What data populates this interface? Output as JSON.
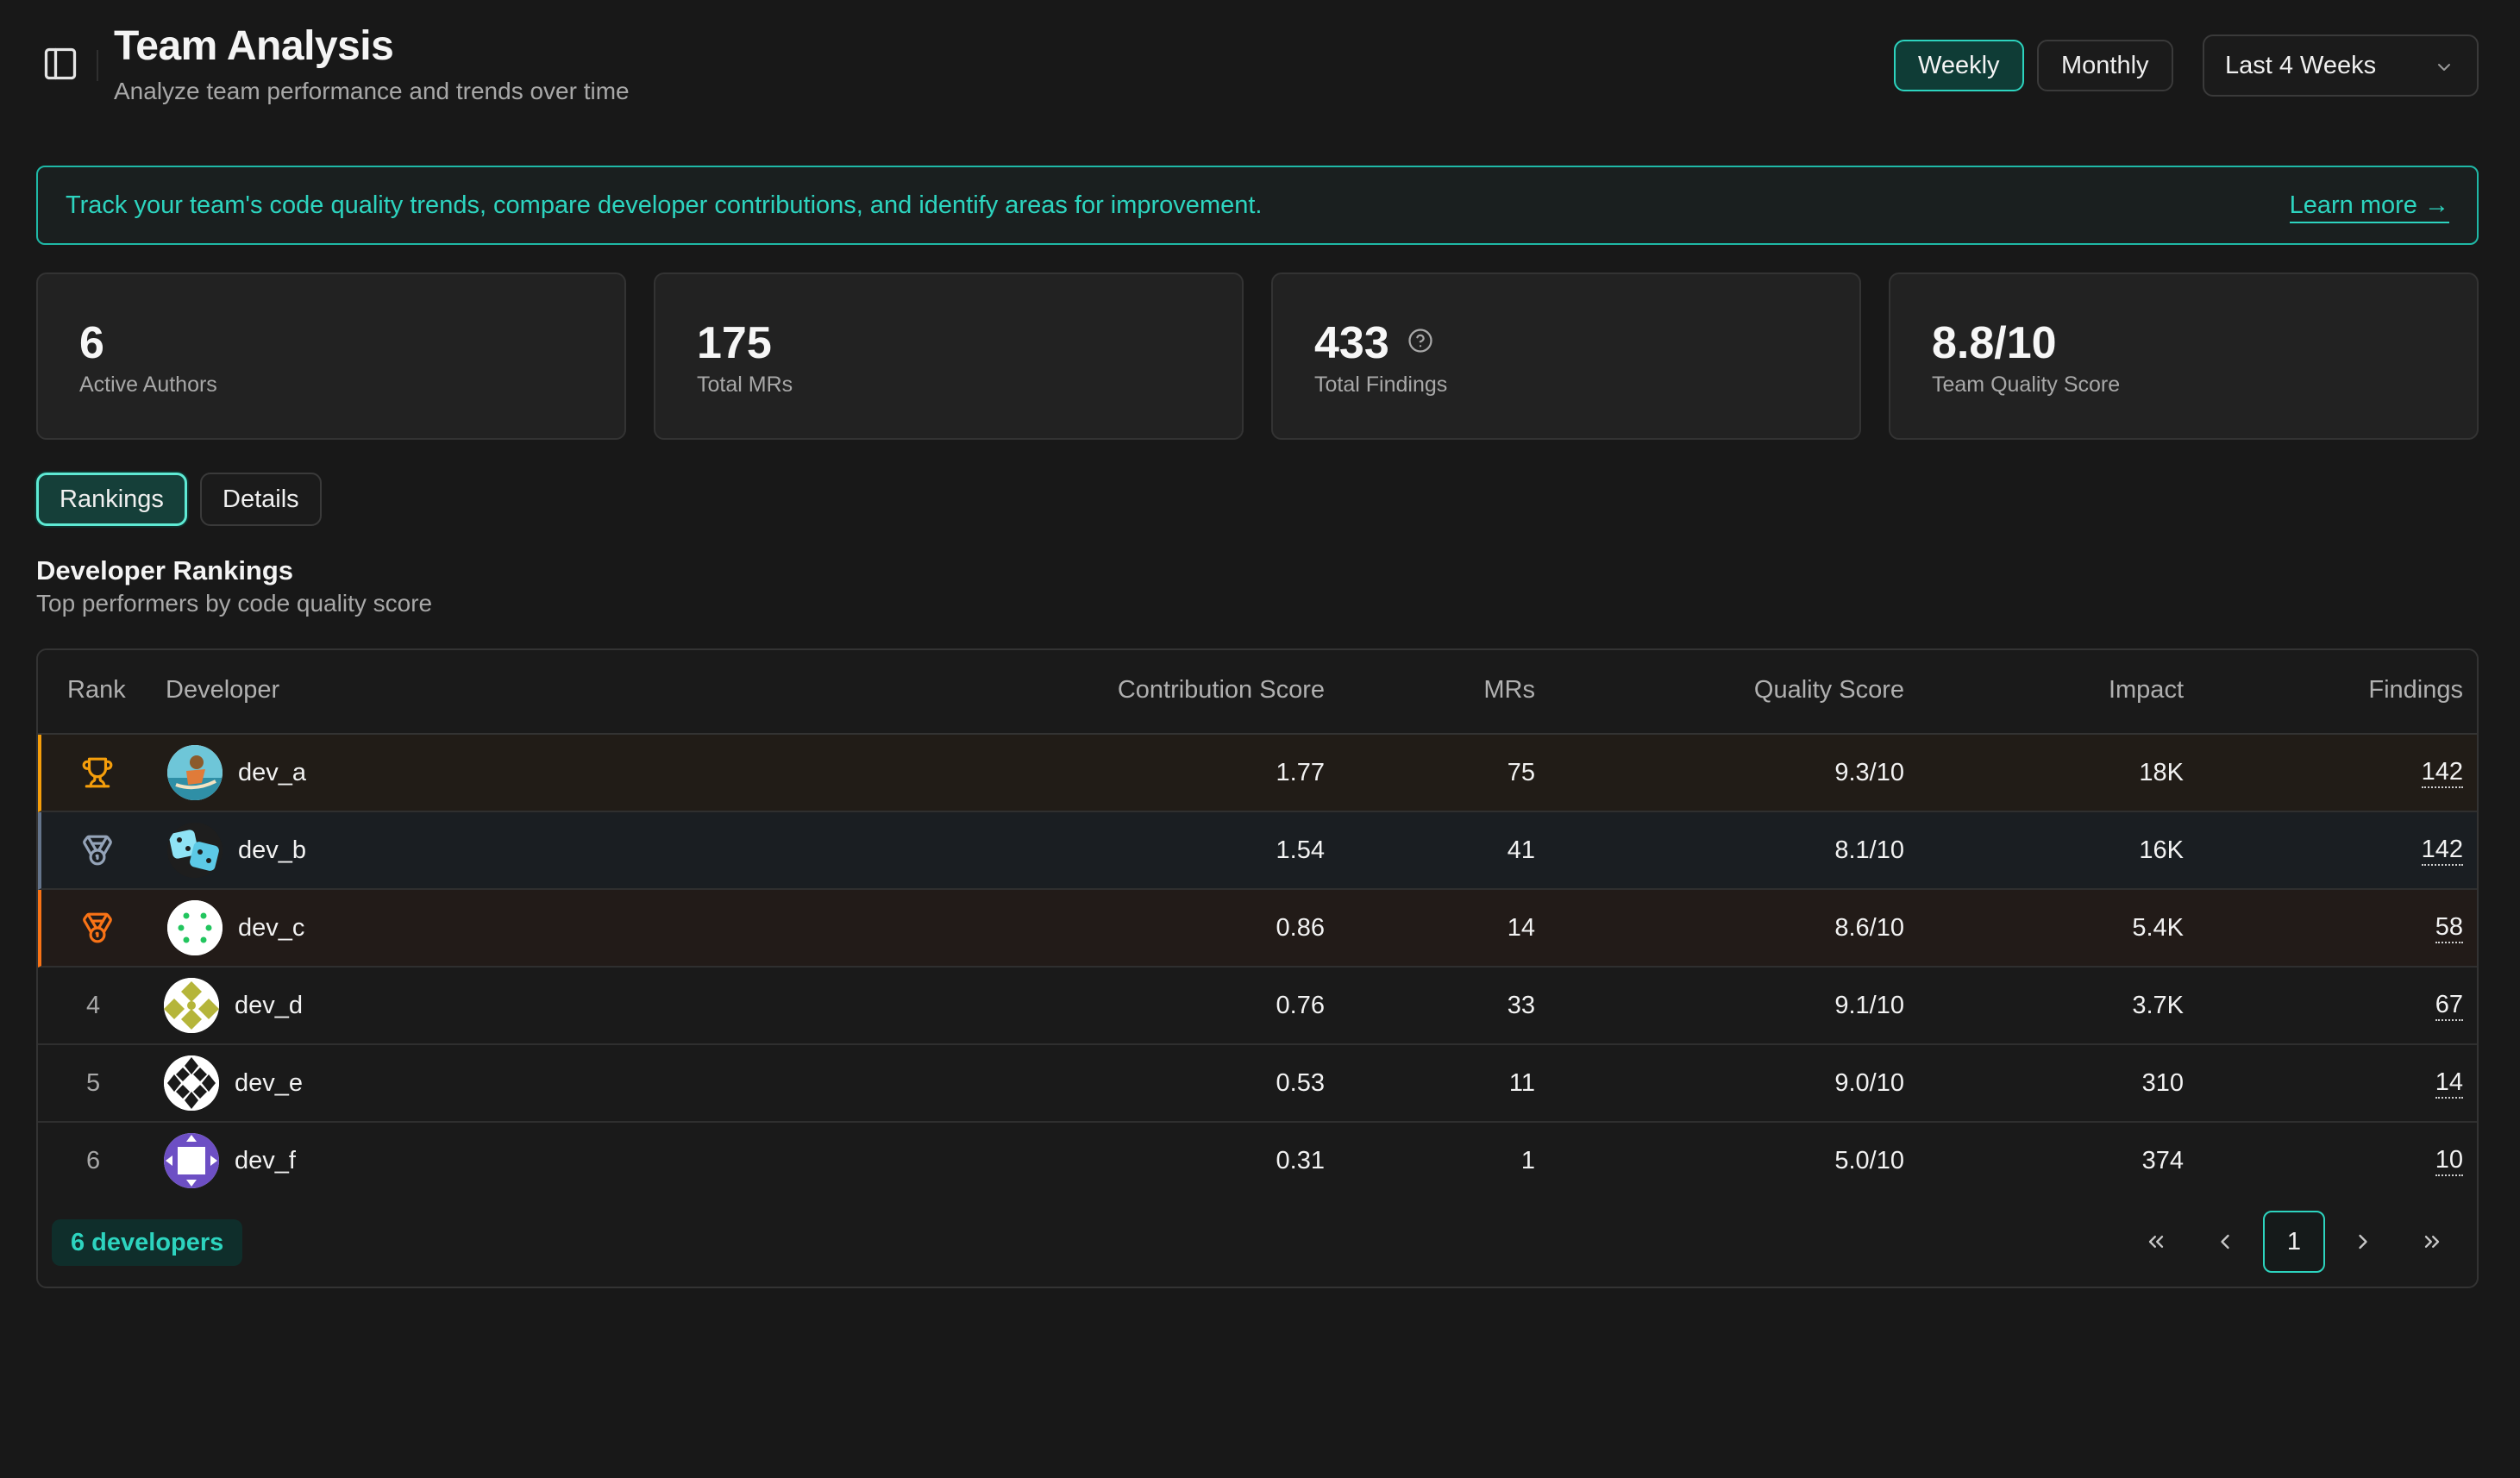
{
  "header": {
    "title": "Team Analysis",
    "subtitle": "Analyze team performance and trends over time",
    "period_options": [
      "Weekly",
      "Monthly"
    ],
    "selected_period": "Weekly",
    "range": "Last 4 Weeks"
  },
  "banner": {
    "text": "Track your team's code quality trends, compare developer contributions, and identify areas for improvement.",
    "link": "Learn more →"
  },
  "stats": [
    {
      "value": "6",
      "label": "Active Authors"
    },
    {
      "value": "175",
      "label": "Total MRs"
    },
    {
      "value": "433",
      "label": "Total Findings"
    },
    {
      "value": "8.8/10",
      "label": "Team Quality Score"
    }
  ],
  "tabs": [
    {
      "label": "Rankings",
      "active": true
    },
    {
      "label": "Details",
      "active": false
    }
  ],
  "section": {
    "title": "Developer Rankings",
    "subtitle": "Top performers by code quality score"
  },
  "table": {
    "columns": [
      "Rank",
      "Developer",
      "Contribution Score",
      "MRs",
      "Quality Score",
      "Impact",
      "Findings"
    ],
    "rows": [
      {
        "rank": "trophy-icon",
        "developer": "dev_a",
        "contribution": "1.77",
        "mrs": "75",
        "quality": "9.3/10",
        "impact": "18K",
        "findings": "142"
      },
      {
        "rank": "silver-medal-icon",
        "developer": "dev_b",
        "contribution": "1.54",
        "mrs": "41",
        "quality": "8.1/10",
        "impact": "16K",
        "findings": "142"
      },
      {
        "rank": "bronze-medal-icon",
        "developer": "dev_c",
        "contribution": "0.86",
        "mrs": "14",
        "quality": "8.6/10",
        "impact": "5.4K",
        "findings": "58"
      },
      {
        "rank": "4",
        "developer": "dev_d",
        "contribution": "0.76",
        "mrs": "33",
        "quality": "9.1/10",
        "impact": "3.7K",
        "findings": "67"
      },
      {
        "rank": "5",
        "developer": "dev_e",
        "contribution": "0.53",
        "mrs": "11",
        "quality": "9.0/10",
        "impact": "310",
        "findings": "14"
      },
      {
        "rank": "6",
        "developer": "dev_f",
        "contribution": "0.31",
        "mrs": "1",
        "quality": "5.0/10",
        "impact": "374",
        "findings": "10"
      }
    ],
    "count_label": "6 developers",
    "current_page": "1"
  },
  "colors": {
    "accent": "#2dd4bf",
    "gold": "#f59e0b",
    "silver": "#64748b",
    "bronze": "#f97316",
    "background": "#181818"
  }
}
